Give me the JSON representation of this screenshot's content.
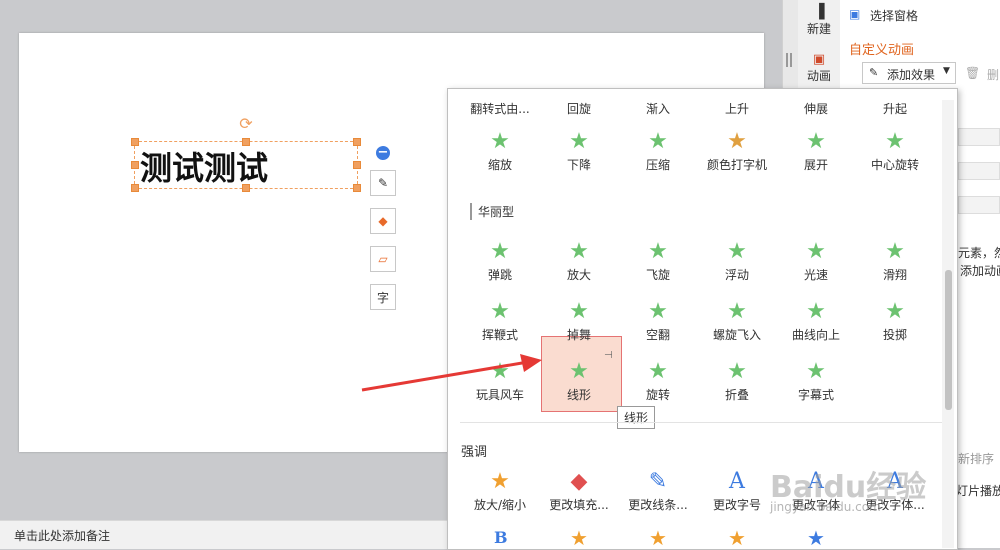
{
  "editor": {
    "slide_text": "测试测试",
    "notes_placeholder": "单击此处添加备注"
  },
  "float_tools": {
    "t1": "✎",
    "t2": "◆",
    "t3": "▱",
    "t4": "字"
  },
  "right_tabs": {
    "new_label": "新建",
    "anim_label": "动画"
  },
  "pane": {
    "select_pane": "选择窗格",
    "custom_anim_title": "自定义动画",
    "add_effect": "添加效果",
    "delete_partial": "删",
    "hint_line1": "元素，然",
    "hint_line2": "添加动画",
    "reorder_partial": "新排序",
    "slideshow_partial": "灯片播放"
  },
  "popup": {
    "row0": [
      "翻转式由...",
      "回旋",
      "渐入",
      "上升",
      "伸展",
      "升起"
    ],
    "row1": [
      "缩放",
      "下降",
      "压缩",
      "颜色打字机",
      "展开",
      "中心旋转"
    ],
    "section_fancy": "华丽型",
    "row2": [
      "弹跳",
      "放大",
      "飞旋",
      "浮动",
      "光速",
      "滑翔"
    ],
    "row3": [
      "挥鞭式",
      "掉舞",
      "空翻",
      "螺旋飞入",
      "曲线向上",
      "投掷"
    ],
    "row4": [
      "玩具风车",
      "线形",
      "旋转",
      "折叠",
      "字幕式"
    ],
    "section_emphasis": "强调",
    "row5": [
      "放大/缩小",
      "更改填充...",
      "更改线条...",
      "更改字号",
      "更改字体",
      "更改字体..."
    ],
    "tooltip": "线形"
  },
  "watermark": {
    "brand": "Baidu经验",
    "url": "jingyan.baidu.com"
  }
}
